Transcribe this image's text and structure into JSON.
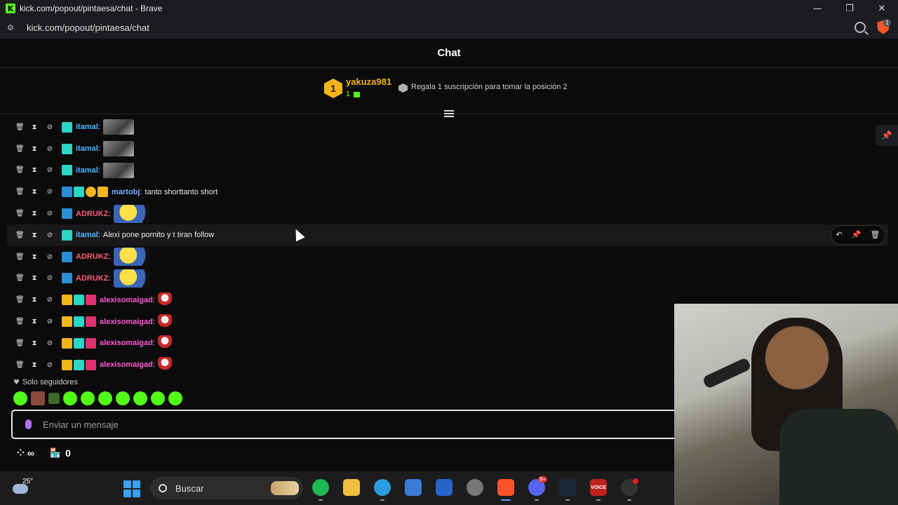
{
  "window": {
    "title": "kick.com/popout/pintaesa/chat - Brave",
    "favicon_letter": "K",
    "minimize": "—",
    "maximize": "❐",
    "close": "✕"
  },
  "address": {
    "url": "kick.com/popout/pintaesa/chat",
    "brave_badge": "1"
  },
  "chat": {
    "title": "Chat"
  },
  "leaderboard": {
    "rank": "1",
    "username": "yakuza981",
    "gift_count": "1",
    "promo": "Regala 1 suscripción para tomar la posición 2"
  },
  "messages": [
    {
      "user": "itamal",
      "color": "#4ab8ff",
      "text": "",
      "emote": "img",
      "badges": [
        "og"
      ]
    },
    {
      "user": "itamal",
      "color": "#4ab8ff",
      "text": "",
      "emote": "img",
      "badges": [
        "og"
      ]
    },
    {
      "user": "itamal",
      "color": "#4ab8ff",
      "text": "",
      "emote": "img",
      "badges": [
        "og"
      ]
    },
    {
      "user": "martobj",
      "color": "#7ab0ff",
      "text": "tanto shorttanto short",
      "emote": "",
      "badges": [
        "vip",
        "og",
        "one",
        "sub2"
      ]
    },
    {
      "user": "ADRUKZ",
      "color": "#ff5a7a",
      "text": "",
      "emote": "minion",
      "badges": [
        "vip"
      ]
    },
    {
      "user": "itamal",
      "color": "#4ab8ff",
      "text": "Alexi pone pornito y t tiran follow",
      "emote": "",
      "badges": [
        "og"
      ]
    },
    {
      "user": "ADRUKZ",
      "color": "#ff5a7a",
      "text": "",
      "emote": "minion",
      "badges": [
        "vip"
      ]
    },
    {
      "user": "ADRUKZ",
      "color": "#ff5a7a",
      "text": "",
      "emote": "minion",
      "badges": [
        "vip"
      ]
    },
    {
      "user": "alexisomaigad",
      "color": "#ff5ad0",
      "text": "",
      "emote": "santa",
      "badges": [
        "crown",
        "og",
        "sub"
      ]
    },
    {
      "user": "alexisomaigad",
      "color": "#ff5ad0",
      "text": "",
      "emote": "santa",
      "badges": [
        "crown",
        "og",
        "sub"
      ]
    },
    {
      "user": "alexisomaigad",
      "color": "#ff5ad0",
      "text": "",
      "emote": "santa",
      "badges": [
        "crown",
        "og",
        "sub"
      ]
    },
    {
      "user": "alexisomaigad",
      "color": "#ff5ad0",
      "text": "",
      "emote": "santa",
      "badges": [
        "crown",
        "og",
        "sub"
      ]
    }
  ],
  "followers_only": "Solo seguidores",
  "input": {
    "placeholder": "Enviar un mensaje"
  },
  "bottom": {
    "points": "∞",
    "store_count": "0"
  },
  "taskbar": {
    "temperature": "25°",
    "search_placeholder": "Buscar",
    "discord_badge": "9+",
    "voicemeeter_label": "VOICE"
  }
}
